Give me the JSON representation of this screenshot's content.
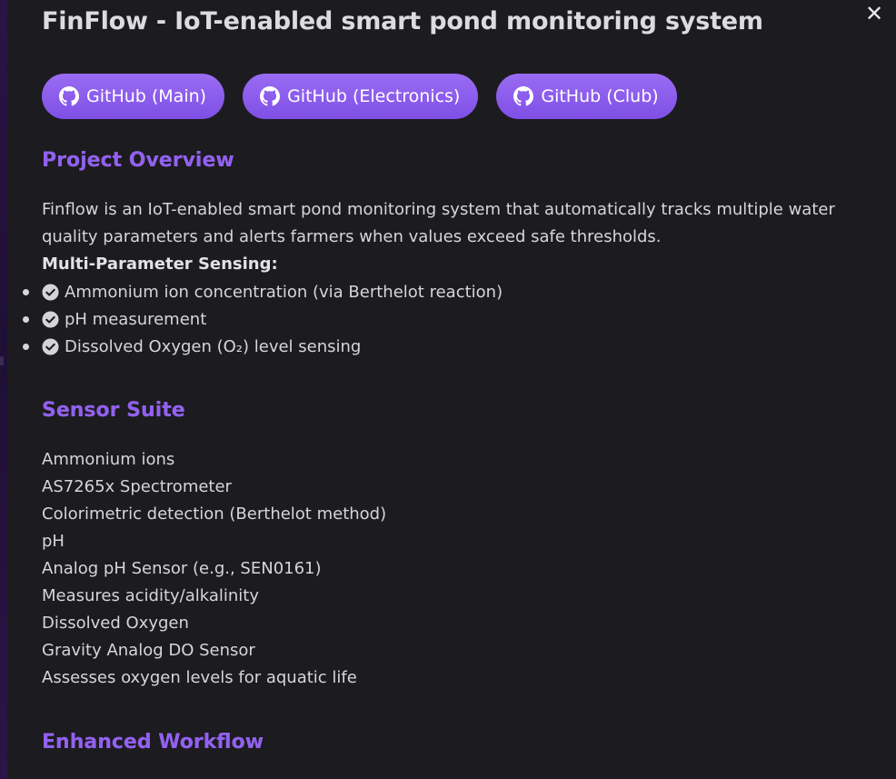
{
  "modal": {
    "title": "FinFlow - IoT-enabled smart pond monitoring system",
    "close_label": "✕"
  },
  "links": [
    {
      "label": "GitHub (Main)",
      "icon": "github-icon"
    },
    {
      "label": "GitHub (Electronics)",
      "icon": "github-icon"
    },
    {
      "label": "GitHub (Club)",
      "icon": "github-icon"
    }
  ],
  "overview": {
    "heading": "Project Overview",
    "description": "Finflow is an IoT-enabled smart pond monitoring system that automatically tracks multiple water quality parameters and alerts farmers when values exceed safe thresholds.",
    "features_heading": "Multi-Parameter Sensing:",
    "features": [
      "Ammonium ion concentration (via Berthelot reaction)",
      "pH measurement",
      "Dissolved Oxygen (O₂) level sensing"
    ]
  },
  "sensor_suite": {
    "heading": "Sensor Suite",
    "items": [
      "Ammonium ions",
      "AS7265x Spectrometer",
      "Colorimetric detection (Berthelot method)",
      "pH",
      "Analog pH Sensor (e.g., SEN0161)",
      "Measures acidity/alkalinity",
      "Dissolved Oxygen",
      "Gravity Analog DO Sensor",
      "Assesses oxygen levels for aquatic life"
    ]
  },
  "workflow": {
    "heading": "Enhanced Workflow"
  },
  "colors": {
    "background": "#1c1b1f",
    "accent": "#9261ee",
    "button": "#8a5cec",
    "text": "#d6d6d8"
  }
}
